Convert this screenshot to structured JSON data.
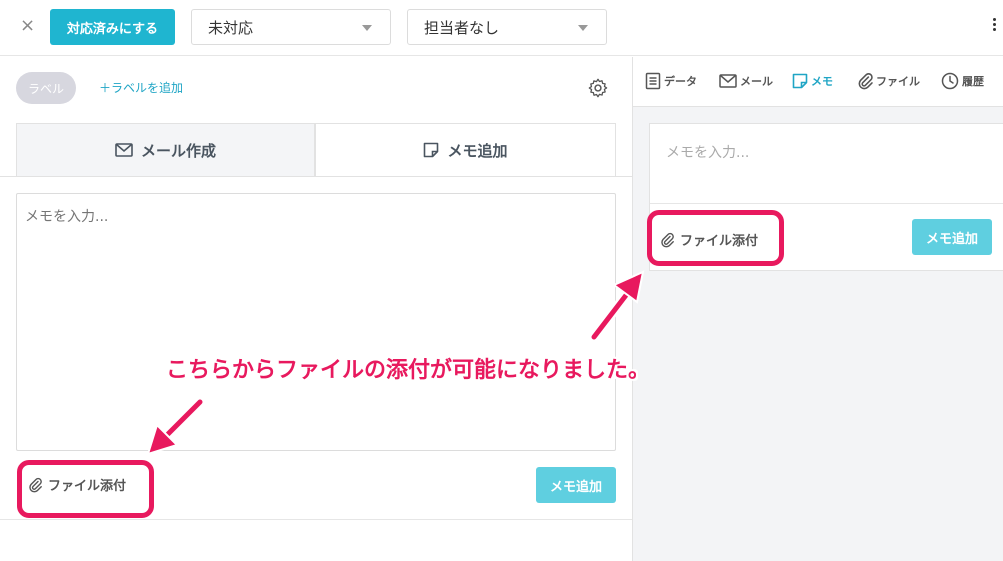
{
  "topbar": {
    "close_glyph": "×",
    "done_button": "対応済みにする",
    "status_select": "未対応",
    "assignee_select": "担当者なし"
  },
  "left": {
    "label_pill": "ラベル",
    "add_label": "＋ラベルを追加",
    "tabs": [
      {
        "label": "メール作成",
        "icon": "mail-icon",
        "active": false
      },
      {
        "label": "メモ追加",
        "icon": "memo-icon",
        "active": true
      }
    ],
    "memo_placeholder": "メモを入力...",
    "attach_label": "ファイル添付",
    "submit_label": "メモ追加"
  },
  "right": {
    "tabs": [
      {
        "label": "データ",
        "icon": "data-icon",
        "active": false
      },
      {
        "label": "メール",
        "icon": "mail-icon",
        "active": false
      },
      {
        "label": "メモ",
        "icon": "memo-icon",
        "active": true
      },
      {
        "label": "ファイル",
        "icon": "paperclip-icon",
        "active": false
      },
      {
        "label": "履歴",
        "icon": "clock-icon",
        "active": false
      }
    ],
    "memo_placeholder": "メモを入力...",
    "attach_label": "ファイル添付",
    "submit_label": "メモ追加"
  },
  "annotation": {
    "text": "こちらからファイルの添付が可能になりました。",
    "color": "#e8195e"
  },
  "colors": {
    "accent": "#1fb5d0",
    "button_light": "#5fcfe0",
    "link": "#1fa5c5"
  }
}
